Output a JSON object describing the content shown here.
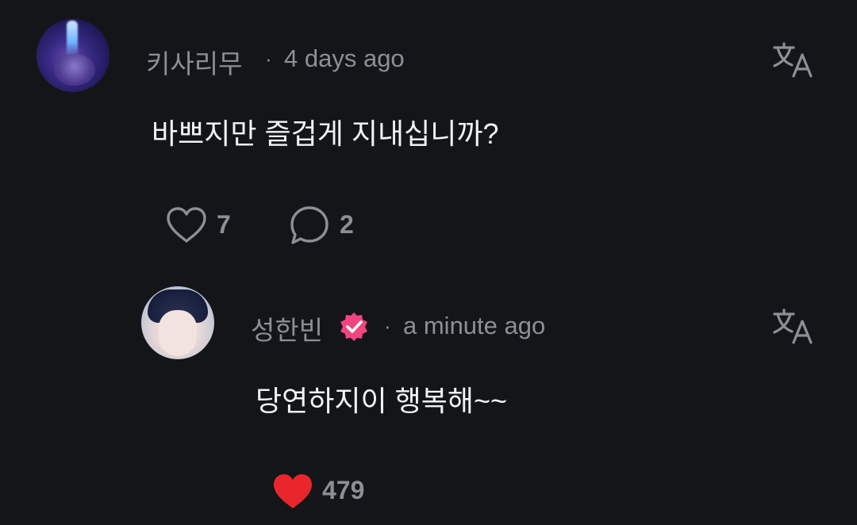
{
  "comment": {
    "username": "키사리무",
    "separator": "·",
    "time": "4 days ago",
    "text": "바쁘지만 즐겁게 지내십니까?",
    "likes": "7",
    "replies": "2",
    "avatar_icon": "user-avatar",
    "translate_icon": "translate-icon"
  },
  "reply": {
    "username": "성한빈",
    "separator": "·",
    "time": "a minute ago",
    "text": "당연하지이 행복해~~",
    "likes": "479",
    "liked": true,
    "verified_badge": "verified-badge-icon",
    "translate_icon": "translate-icon"
  },
  "colors": {
    "background": "#141519",
    "muted_text": "#8d8f96",
    "body_text": "#f2f3f5",
    "like_active": "#e8262b",
    "verified_badge": "#f0457f"
  }
}
